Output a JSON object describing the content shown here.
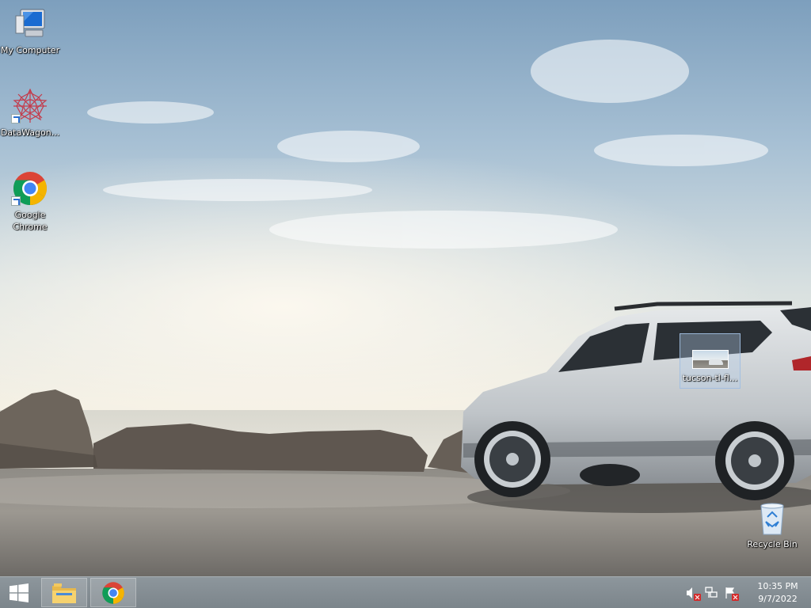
{
  "desktop": {
    "icons": [
      {
        "label": "My Computer",
        "icon": "computer-icon",
        "shortcut": false
      },
      {
        "label": "DataWagon...",
        "icon": "datawagon-icon",
        "shortcut": true
      },
      {
        "label": "Google Chrome",
        "icon": "chrome-icon",
        "shortcut": true
      },
      {
        "label": "tucson-tl-fl...",
        "icon": "image-file-icon",
        "selected": true
      },
      {
        "label": "Recycle Bin",
        "icon": "recycle-bin-icon",
        "shortcut": false
      }
    ]
  },
  "taskbar": {
    "start": {
      "icon": "windows-logo-icon"
    },
    "pinned": [
      {
        "name": "File Explorer",
        "icon": "folder-icon"
      },
      {
        "name": "Google Chrome",
        "icon": "chrome-icon"
      }
    ],
    "tray": {
      "icons": [
        "volume-muted-icon",
        "network-disconnected-icon",
        "action-center-alert-icon"
      ],
      "time": "10:35 PM",
      "date": "9/7/2022"
    }
  },
  "colors": {
    "taskbar": "#848d93",
    "alert_red": "#d42a2a"
  }
}
